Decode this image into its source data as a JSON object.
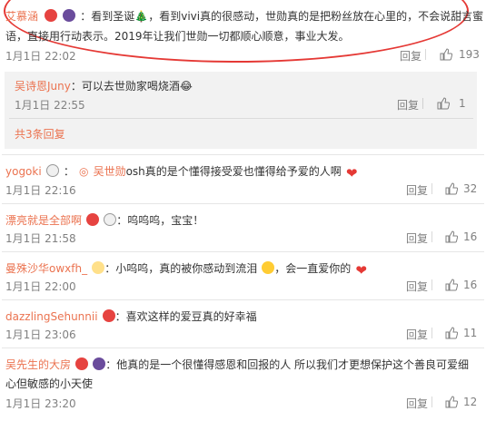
{
  "c1": {
    "name": "艾慕涵",
    "line1": "：看到圣诞🎄，看到vivi真的很感动，世勋真的是把粉丝放在心里的，不会说甜言蜜",
    "line2": "语，直接用行动表示。2019年让我们世勋一切都顺心顺意，事业大发。",
    "time": "1月1日 22:02",
    "reply": "回复",
    "likes": "193"
  },
  "r1": {
    "name": "吴诗恩Juny",
    "text": "：可以去世勋家喝烧酒😂",
    "time": "1月1日 22:55",
    "reply": "回复",
    "likes": "1"
  },
  "more_replies": "共3条回复",
  "c2": {
    "name": "yogoki",
    "mention": "吴世勋",
    "text": "osh真的是个懂得接受爱也懂得给予爱的人啊",
    "time": "1月1日 22:16",
    "reply": "回复",
    "likes": "32"
  },
  "c3": {
    "name": "漂亮就是全部啊",
    "text": "：呜呜呜，宝宝！",
    "time": "1月1日 21:58",
    "reply": "回复",
    "likes": "16"
  },
  "c4": {
    "name": "曼殊沙华owxfh_",
    "text": "：小呜呜，真的被你感动到流泪",
    "text2": "，会一直爱你的",
    "time": "1月1日 22:00",
    "reply": "回复",
    "likes": "16"
  },
  "c5": {
    "name": "dazzlingSehunnii",
    "text": "：喜欢这样的爱豆真的好幸福",
    "time": "1月1日 23:06",
    "reply": "回复",
    "likes": "11"
  },
  "c6": {
    "name": "吴先生的大房",
    "line1": "：他真的是一个很懂得感恩和回报的人 所以我们才更想保护这个善良可爱细",
    "line2": "心但敏感的小天使",
    "time": "1月1日 23:20",
    "reply": "回复",
    "likes": "12"
  },
  "colors": {
    "link": "#eb7350",
    "meta": "#808080",
    "highlight": "#e53935"
  }
}
